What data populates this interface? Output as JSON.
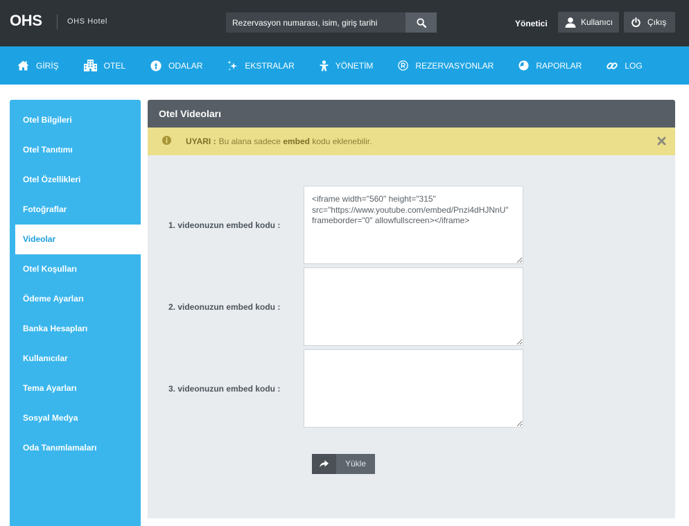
{
  "header": {
    "logo": "OHS",
    "hotel_name": "OHS Hotel",
    "search": {
      "placeholder": "Rezervasyon numarası, isim, giriş tarihi",
      "value": "",
      "icon": "search-icon"
    },
    "role": "Yönetici",
    "user_button": {
      "label": "Kullanıcı",
      "icon": "user-icon"
    },
    "logout_button": {
      "label": "Çıkış",
      "icon": "power-icon"
    }
  },
  "nav": [
    {
      "label": "GİRİŞ",
      "icon": "home-icon"
    },
    {
      "label": "OTEL",
      "icon": "building-icon"
    },
    {
      "label": "ODALAR",
      "icon": "rooms-icon"
    },
    {
      "label": "EKSTRALAR",
      "icon": "sparkle-icon"
    },
    {
      "label": "YÖNETİM",
      "icon": "person-icon"
    },
    {
      "label": "REZERVASYONLAR",
      "icon": "registered-icon"
    },
    {
      "label": "RAPORLAR",
      "icon": "pie-chart-icon"
    },
    {
      "label": "LOG",
      "icon": "link-icon"
    }
  ],
  "sidebar": {
    "active_index": 4,
    "items": [
      {
        "label": "Otel Bilgileri"
      },
      {
        "label": "Otel Tanıtımı"
      },
      {
        "label": "Otel Özellikleri"
      },
      {
        "label": "Fotoğraflar"
      },
      {
        "label": "Videolar"
      },
      {
        "label": "Otel Koşulları"
      },
      {
        "label": "Ödeme Ayarları"
      },
      {
        "label": "Banka Hesapları"
      },
      {
        "label": "Kullanıcılar"
      },
      {
        "label": "Tema Ayarları"
      },
      {
        "label": "Sosyal Medya"
      },
      {
        "label": "Oda Tanımlamaları"
      }
    ]
  },
  "panel": {
    "title": "Otel Videoları",
    "alert": {
      "icon": "info-icon",
      "label": "UYARI :",
      "text_before": "Bu alana sadece ",
      "emphasis": "embed",
      "text_after": " kodu eklenebilir.",
      "close_icon": "close-icon"
    },
    "fields": [
      {
        "label": "1. videonuzun embed kodu :",
        "value": "<iframe width=\"560\" height=\"315\" src=\"https://www.youtube.com/embed/Pnzi4dHJNnU\" frameborder=\"0\" allowfullscreen></iframe>"
      },
      {
        "label": "2. videonuzun embed kodu :",
        "value": ""
      },
      {
        "label": "3. videonuzun embed kodu :",
        "value": ""
      }
    ],
    "submit": {
      "label": "Yükle",
      "icon": "share-icon"
    }
  },
  "colors": {
    "header_bg": "#2e3338",
    "nav_bg": "#1da3e3",
    "sidebar_bg": "#3ab6ed",
    "active_text": "#1a9fdf",
    "panel_header_bg": "#575e65",
    "alert_bg": "#ebdf8c",
    "alert_text": "#8d7d33",
    "content_bg": "#e8ecef",
    "button_bg": "#5e656c"
  }
}
